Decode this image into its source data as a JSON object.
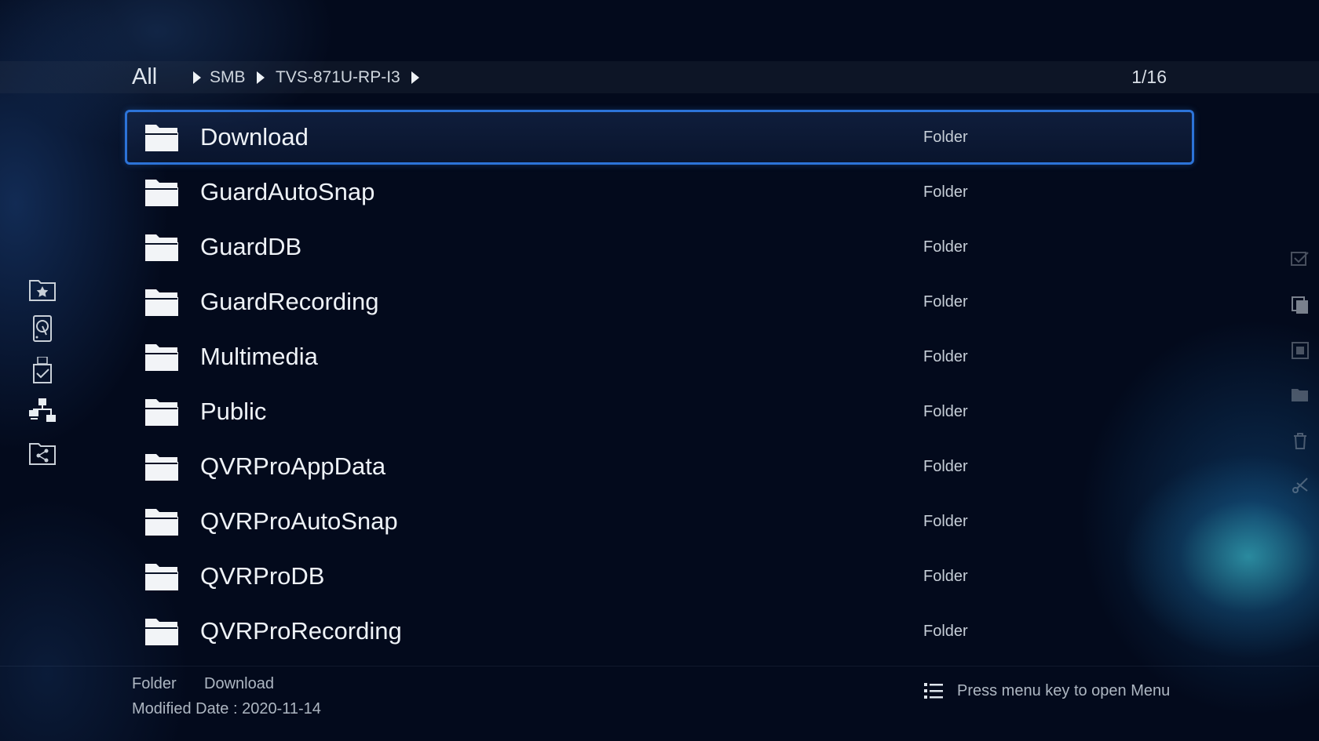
{
  "breadcrumb": {
    "root": "All",
    "items": [
      "SMB",
      "TVS-871U-RP-I3"
    ]
  },
  "pager": "1/16",
  "sidebar": {
    "icons": [
      "favorite-folder-icon",
      "hard-disk-icon",
      "usb-device-icon",
      "network-icon",
      "shared-folder-icon"
    ]
  },
  "right_rail": {
    "icons": [
      "select-icon",
      "copy-icon",
      "move-icon",
      "open-folder-icon",
      "delete-icon",
      "cut-icon"
    ]
  },
  "files": [
    {
      "name": "Download",
      "type": "Folder"
    },
    {
      "name": "GuardAutoSnap",
      "type": "Folder"
    },
    {
      "name": "GuardDB",
      "type": "Folder"
    },
    {
      "name": "GuardRecording",
      "type": "Folder"
    },
    {
      "name": "Multimedia",
      "type": "Folder"
    },
    {
      "name": "Public",
      "type": "Folder"
    },
    {
      "name": "QVRProAppData",
      "type": "Folder"
    },
    {
      "name": "QVRProAutoSnap",
      "type": "Folder"
    },
    {
      "name": "QVRProDB",
      "type": "Folder"
    },
    {
      "name": "QVRProRecording",
      "type": "Folder"
    }
  ],
  "selected_index": 0,
  "footer": {
    "item_type": "Folder",
    "item_name": "Download",
    "modified": "Modified Date : 2020-11-14",
    "menu_hint": "Press menu key to open Menu"
  },
  "colors": {
    "background": "#030a1c",
    "selection_border": "#2c73d8",
    "text": "#eef2f7"
  }
}
